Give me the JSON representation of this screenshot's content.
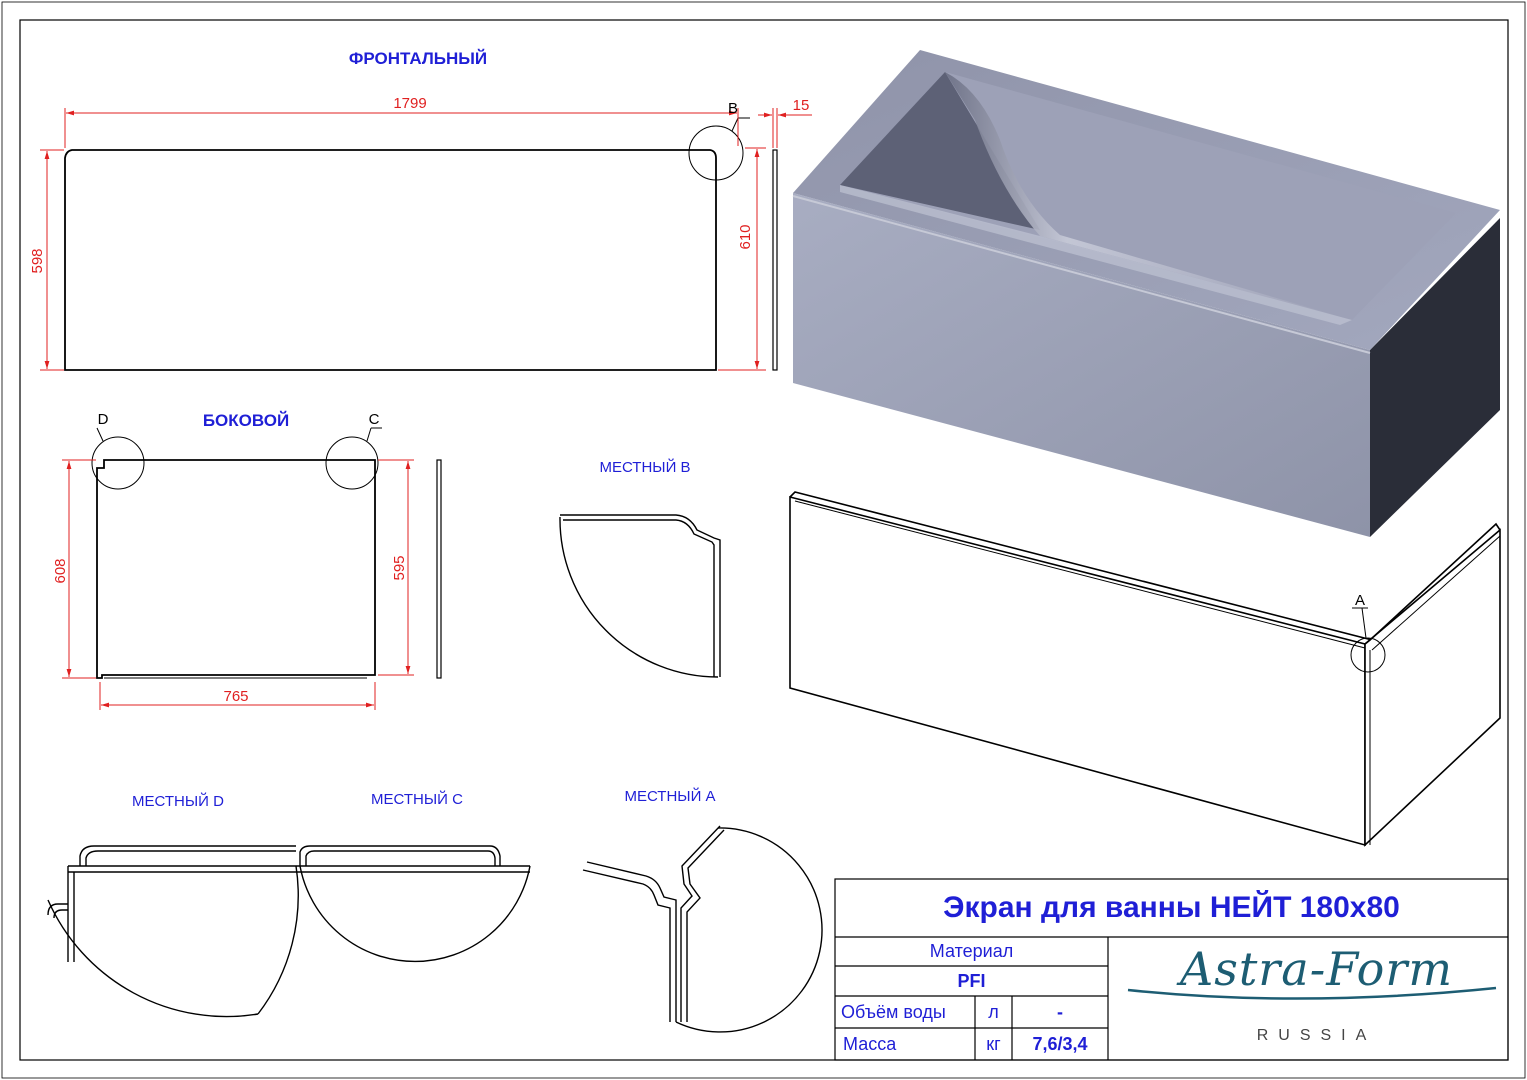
{
  "views": {
    "front": "ФРОНТАЛЬНЫЙ",
    "side": "БОКОВОЙ",
    "detail_b": "МЕСТНЫЙ В",
    "detail_d": "МЕСТНЫЙ D",
    "detail_c": "МЕСТНЫЙ С",
    "detail_a": "МЕСТНЫЙ А"
  },
  "dimensions": {
    "front_width": "1799",
    "front_thickness": "15",
    "front_height_left": "598",
    "front_height_right": "610",
    "side_height_left": "608",
    "side_height_right": "595",
    "side_width": "765"
  },
  "detail_markers": {
    "b": "B",
    "d": "D",
    "c": "C",
    "a": "A"
  },
  "title_block": {
    "title": "Экран для ванны НЕЙТ 180х80",
    "material_label": "Материал",
    "material_value": "PFI",
    "volume_label": "Объём воды",
    "volume_unit": "л",
    "volume_value": "-",
    "mass_label": "Масса",
    "mass_unit": "кг",
    "mass_value": "7,6/3,4"
  },
  "logo": {
    "name": "Astra-Form",
    "sub": "RUSSIA"
  },
  "colors": {
    "dimension": "#e02020",
    "label": "#1f1fd6",
    "logo": "#1d5d73"
  }
}
